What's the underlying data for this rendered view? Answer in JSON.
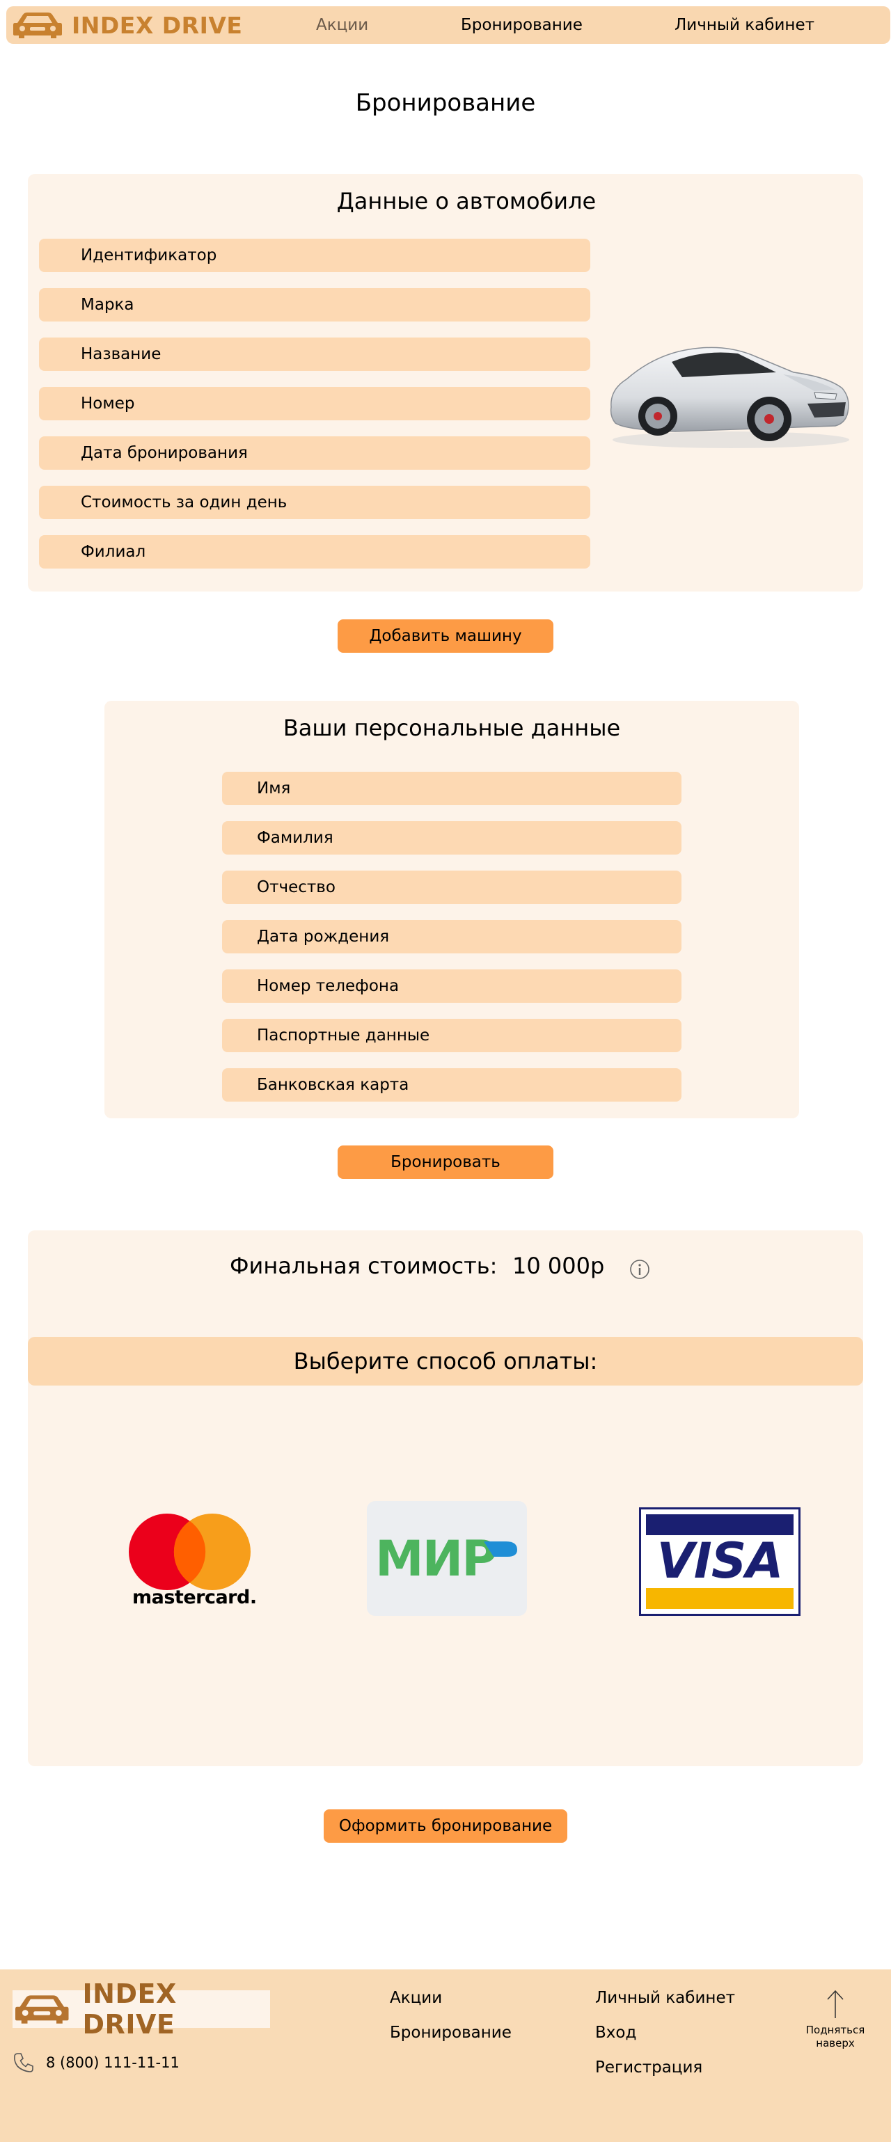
{
  "header": {
    "brand": "INDEX DRIVE",
    "nav": [
      "Акции",
      "Бронирование",
      "Личный кабинет"
    ]
  },
  "page_title": "Бронирование",
  "car_panel": {
    "title": "Данные о автомобиле",
    "fields": [
      "Идентификатор",
      "Марка",
      "Название",
      "Номер",
      "Дата бронирования",
      "Стоимость за один день",
      "Филиал"
    ],
    "image": "sports-car-image"
  },
  "add_car_button": "Добавить машину",
  "personal_panel": {
    "title": "Ваши персональные данные",
    "fields": [
      "Имя",
      "Фамилия",
      "Отчество",
      "Дата рождения",
      "Номер телефона",
      "Паспортные данные",
      "Банковская карта"
    ]
  },
  "book_button": "Бронировать",
  "final": {
    "label": "Финальная стоимость:",
    "price": "10 000р",
    "info_icon": "info-icon"
  },
  "payment": {
    "title": "Выберите способ оплаты:",
    "methods": [
      {
        "name": "mastercard",
        "text": "mastercard."
      },
      {
        "name": "mir",
        "text": "МИР"
      },
      {
        "name": "visa",
        "text": "VISA"
      }
    ],
    "colors": {
      "mc_red": "#eb001b",
      "mc_orange": "#f79e1b",
      "mir_green": "#4db45e",
      "visa_blue": "#1a1f71",
      "visa_gold": "#f7b600"
    }
  },
  "checkout_button": "Оформить бронирование",
  "footer": {
    "brand": "INDEX DRIVE",
    "col1": [
      "Акции",
      "Бронирование"
    ],
    "col2": [
      "Личный кабинет",
      "Вход",
      "Регистрация"
    ],
    "phone": "8 (800) 111-11-11",
    "up_line1": "Подняться",
    "up_line2": "наверх"
  },
  "colors": {
    "header_bg": "#f9d7b0",
    "panel_bg": "#fdf3e9",
    "field_bg": "#fdd9b3",
    "button": "#fd9b45",
    "brand": "#c8812f"
  }
}
